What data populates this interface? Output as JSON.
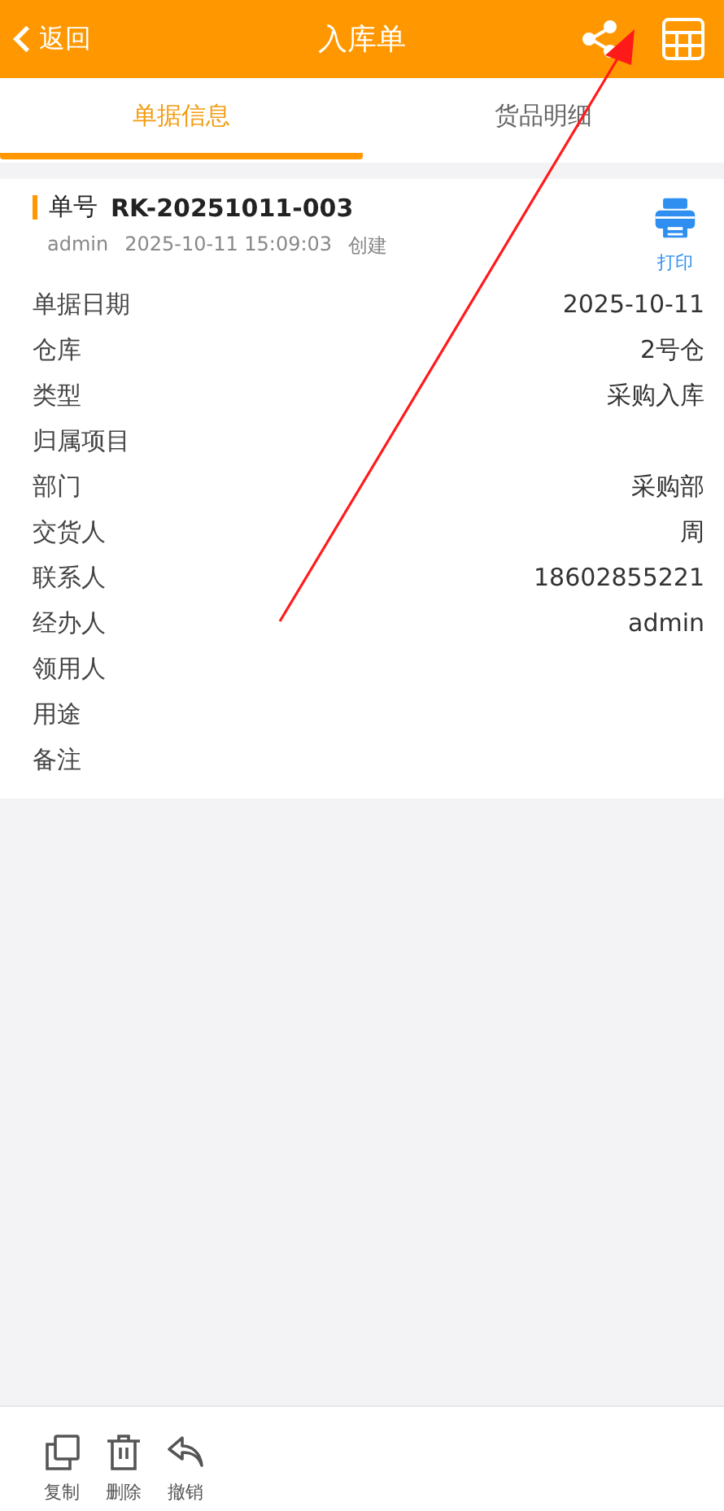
{
  "header": {
    "back": "返回",
    "title": "入库单"
  },
  "tabs": [
    {
      "label": "单据信息",
      "selected": true
    },
    {
      "label": "货品明细",
      "selected": false
    }
  ],
  "document": {
    "number_label": "单号",
    "number": "RK-20251011-003",
    "creator": "admin",
    "created_at": "2025-10-11 15:09:03",
    "action": "创建",
    "print": "打印"
  },
  "fields": [
    {
      "label": "单据日期",
      "value": "2025-10-11"
    },
    {
      "label": "仓库",
      "value": "2号仓"
    },
    {
      "label": "类型",
      "value": "采购入库"
    },
    {
      "label": "归属项目"
    },
    {
      "label": "部门",
      "value": "采购部"
    },
    {
      "label": "交货人",
      "value": "周"
    },
    {
      "label": "联系人",
      "value": "18602855221"
    },
    {
      "label": "经办人",
      "value": "admin"
    },
    {
      "label": "领用人"
    },
    {
      "label": "用途"
    },
    {
      "label": "备注"
    }
  ],
  "actions": [
    {
      "kind": "copy",
      "label": "复制"
    },
    {
      "kind": "delete",
      "label": "删除"
    },
    {
      "kind": "undo",
      "label": "撤销"
    }
  ]
}
